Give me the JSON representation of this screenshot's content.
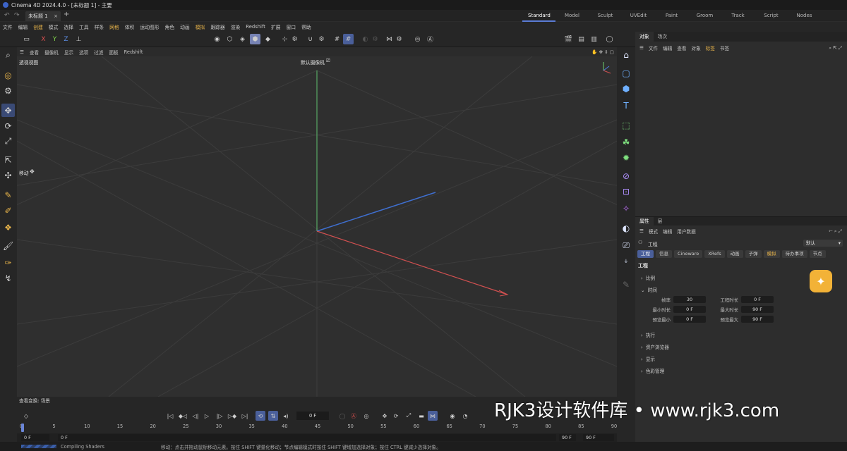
{
  "titlebar": {
    "title": "Cinema 4D 2024.4.0 - [未标题 1] - 主要"
  },
  "tabs": {
    "doc_tab": "未标题 1",
    "close": "×",
    "new": "+"
  },
  "layouts": [
    "Standard",
    "Model",
    "Sculpt",
    "UVEdit",
    "Paint",
    "Groom",
    "Track",
    "Script",
    "Nodes"
  ],
  "menu": [
    "文件",
    "编辑",
    "创建",
    "模式",
    "选择",
    "工具",
    "样条",
    "网格",
    "体积",
    "运动图形",
    "角色",
    "动画",
    "模拟",
    "跟踪器",
    "渲染",
    "Redshift",
    "扩展",
    "窗口",
    "帮助"
  ],
  "axes": {
    "x": "X",
    "y": "Y",
    "z": "Z"
  },
  "viewport": {
    "menu": [
      "查看",
      "摄像机",
      "显示",
      "选项",
      "过滤",
      "面板",
      "Redshift"
    ],
    "label": "透视视图",
    "camera": "默认摄像机",
    "camera_icon": "⎚",
    "tool": "移动",
    "tool_icon": "✥",
    "info": "查看变换: 场景"
  },
  "objects_panel": {
    "tabs": [
      "对象",
      "场次"
    ],
    "menu": [
      "文件",
      "编辑",
      "查看",
      "对象",
      "标签",
      "书签"
    ]
  },
  "attributes_panel": {
    "tabs": [
      "属性",
      "层"
    ],
    "menu": [
      "模式",
      "编辑",
      "用户数据"
    ],
    "title": "工程",
    "preset": "默认",
    "subtabs": [
      "工程",
      "信息",
      "Cineware",
      "XRefs",
      "动画",
      "子弹",
      "模拟",
      "待办事项",
      "节点"
    ],
    "heading": "工程",
    "sections": {
      "scale": "比例",
      "time": "时间",
      "exec": "执行",
      "asset": "资产浏览器",
      "display": "显示",
      "color": "色彩管理"
    },
    "fields": {
      "fps_label": "帧率",
      "fps": "30",
      "proj_len_label": "工程时长",
      "proj_len": "0 F",
      "min_label": "最小时长",
      "min": "0 F",
      "max_label": "最大时长",
      "max": "90 F",
      "pmin_label": "预览最小",
      "pmin": "0 F",
      "pmax_label": "预览最大",
      "pmax": "90 F"
    }
  },
  "timeline": {
    "current_frame": "0 F",
    "ticks": [
      "0",
      "5",
      "10",
      "15",
      "20",
      "25",
      "30",
      "35",
      "40",
      "45",
      "50",
      "55",
      "60",
      "65",
      "70",
      "75",
      "80",
      "85",
      "90"
    ],
    "start": "0 F",
    "start2": "0 F",
    "end": "90 F",
    "end2": "90 F"
  },
  "status": {
    "task": "Compiling Shaders",
    "hint": "移动：点击并拖动鼠标移动元素。按住 SHIFT 键量化移动；节点编辑模式时按住 SHIFT 键增加选择对象；按住 CTRL 键减少选择对象。"
  },
  "watermark": "RJK3设计软件库 • www.rjk3.com"
}
